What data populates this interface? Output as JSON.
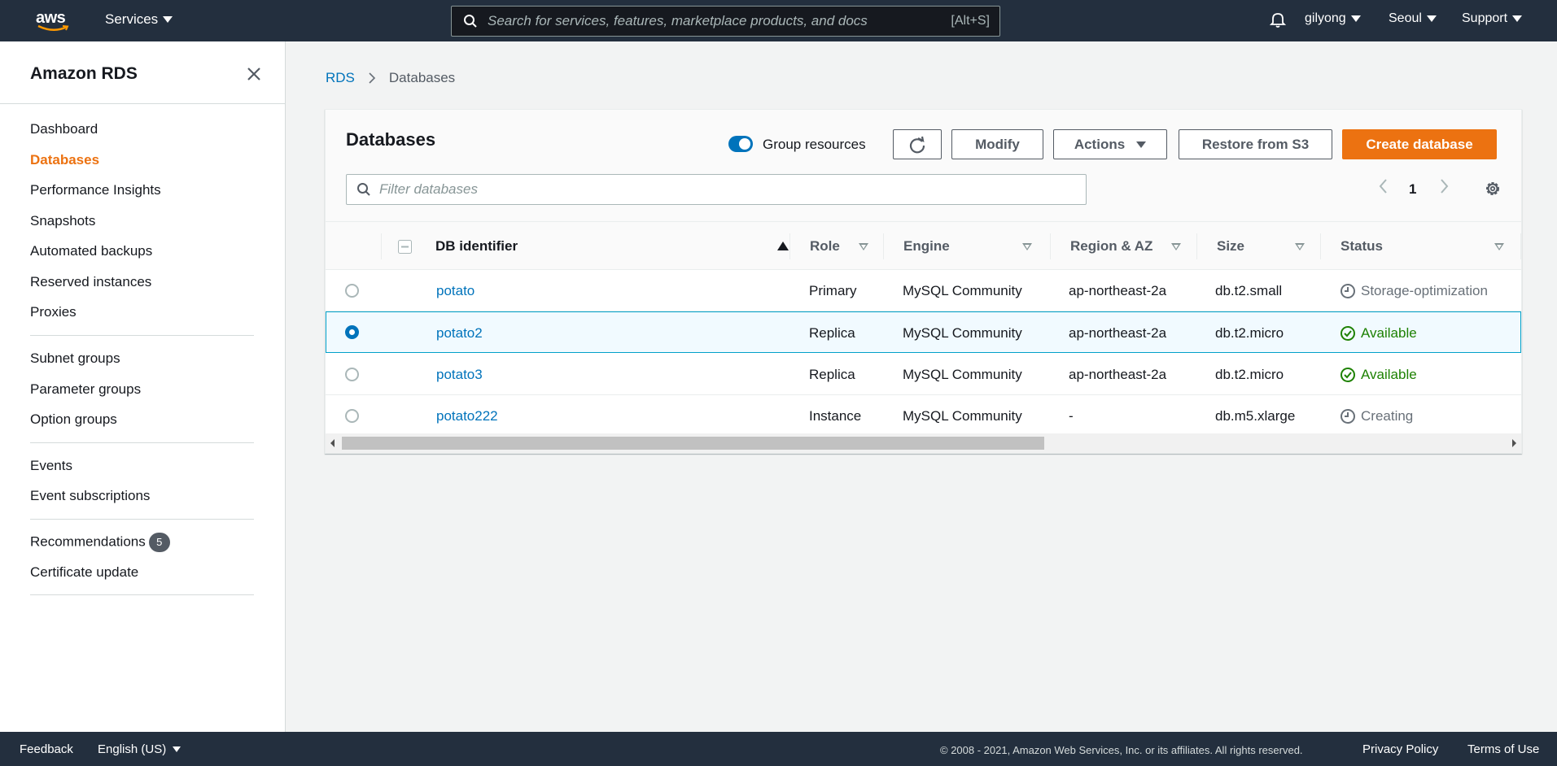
{
  "topnav": {
    "logo_text": "aws",
    "services_label": "Services",
    "search_placeholder": "Search for services, features, marketplace products, and docs",
    "search_shortcut": "[Alt+S]",
    "user": "gilyong",
    "region": "Seoul",
    "support": "Support"
  },
  "sidebar": {
    "title": "Amazon RDS",
    "group1": [
      "Dashboard",
      "Databases",
      "Performance Insights",
      "Snapshots",
      "Automated backups",
      "Reserved instances",
      "Proxies"
    ],
    "group2": [
      "Subnet groups",
      "Parameter groups",
      "Option groups"
    ],
    "group3": [
      "Events",
      "Event subscriptions"
    ],
    "recommendations_label": "Recommendations",
    "recommendations_count": "5",
    "certificate_update": "Certificate update",
    "active_item": "Databases"
  },
  "breadcrumb": {
    "root": "RDS",
    "current": "Databases"
  },
  "panel": {
    "title": "Databases",
    "group_resources_label": "Group resources",
    "group_resources_on": true,
    "modify_label": "Modify",
    "actions_label": "Actions",
    "restore_label": "Restore from S3",
    "create_label": "Create database",
    "filter_placeholder": "Filter databases",
    "page_number": "1"
  },
  "table": {
    "columns": [
      "DB identifier",
      "Role",
      "Engine",
      "Region & AZ",
      "Size",
      "Status"
    ],
    "rows": [
      {
        "id": "potato",
        "role": "Primary",
        "engine": "MySQL Community",
        "region": "ap-northeast-2a",
        "size": "db.t2.small",
        "status": "Storage-optimization",
        "status_kind": "pending",
        "selected": false
      },
      {
        "id": "potato2",
        "role": "Replica",
        "engine": "MySQL Community",
        "region": "ap-northeast-2a",
        "size": "db.t2.micro",
        "status": "Available",
        "status_kind": "ok",
        "selected": true
      },
      {
        "id": "potato3",
        "role": "Replica",
        "engine": "MySQL Community",
        "region": "ap-northeast-2a",
        "size": "db.t2.micro",
        "status": "Available",
        "status_kind": "ok",
        "selected": false
      },
      {
        "id": "potato222",
        "role": "Instance",
        "engine": "MySQL Community",
        "region": "-",
        "size": "db.m5.xlarge",
        "status": "Creating",
        "status_kind": "pending",
        "selected": false
      }
    ]
  },
  "footer": {
    "feedback": "Feedback",
    "language": "English (US)",
    "copyright": "© 2008 - 2021, Amazon Web Services, Inc. or its affiliates. All rights reserved.",
    "privacy": "Privacy Policy",
    "terms": "Terms of Use"
  },
  "colors": {
    "nav_bg": "#232f3e",
    "accent_orange": "#ec7211",
    "link_blue": "#0073bb",
    "ok_green": "#1d8102"
  }
}
